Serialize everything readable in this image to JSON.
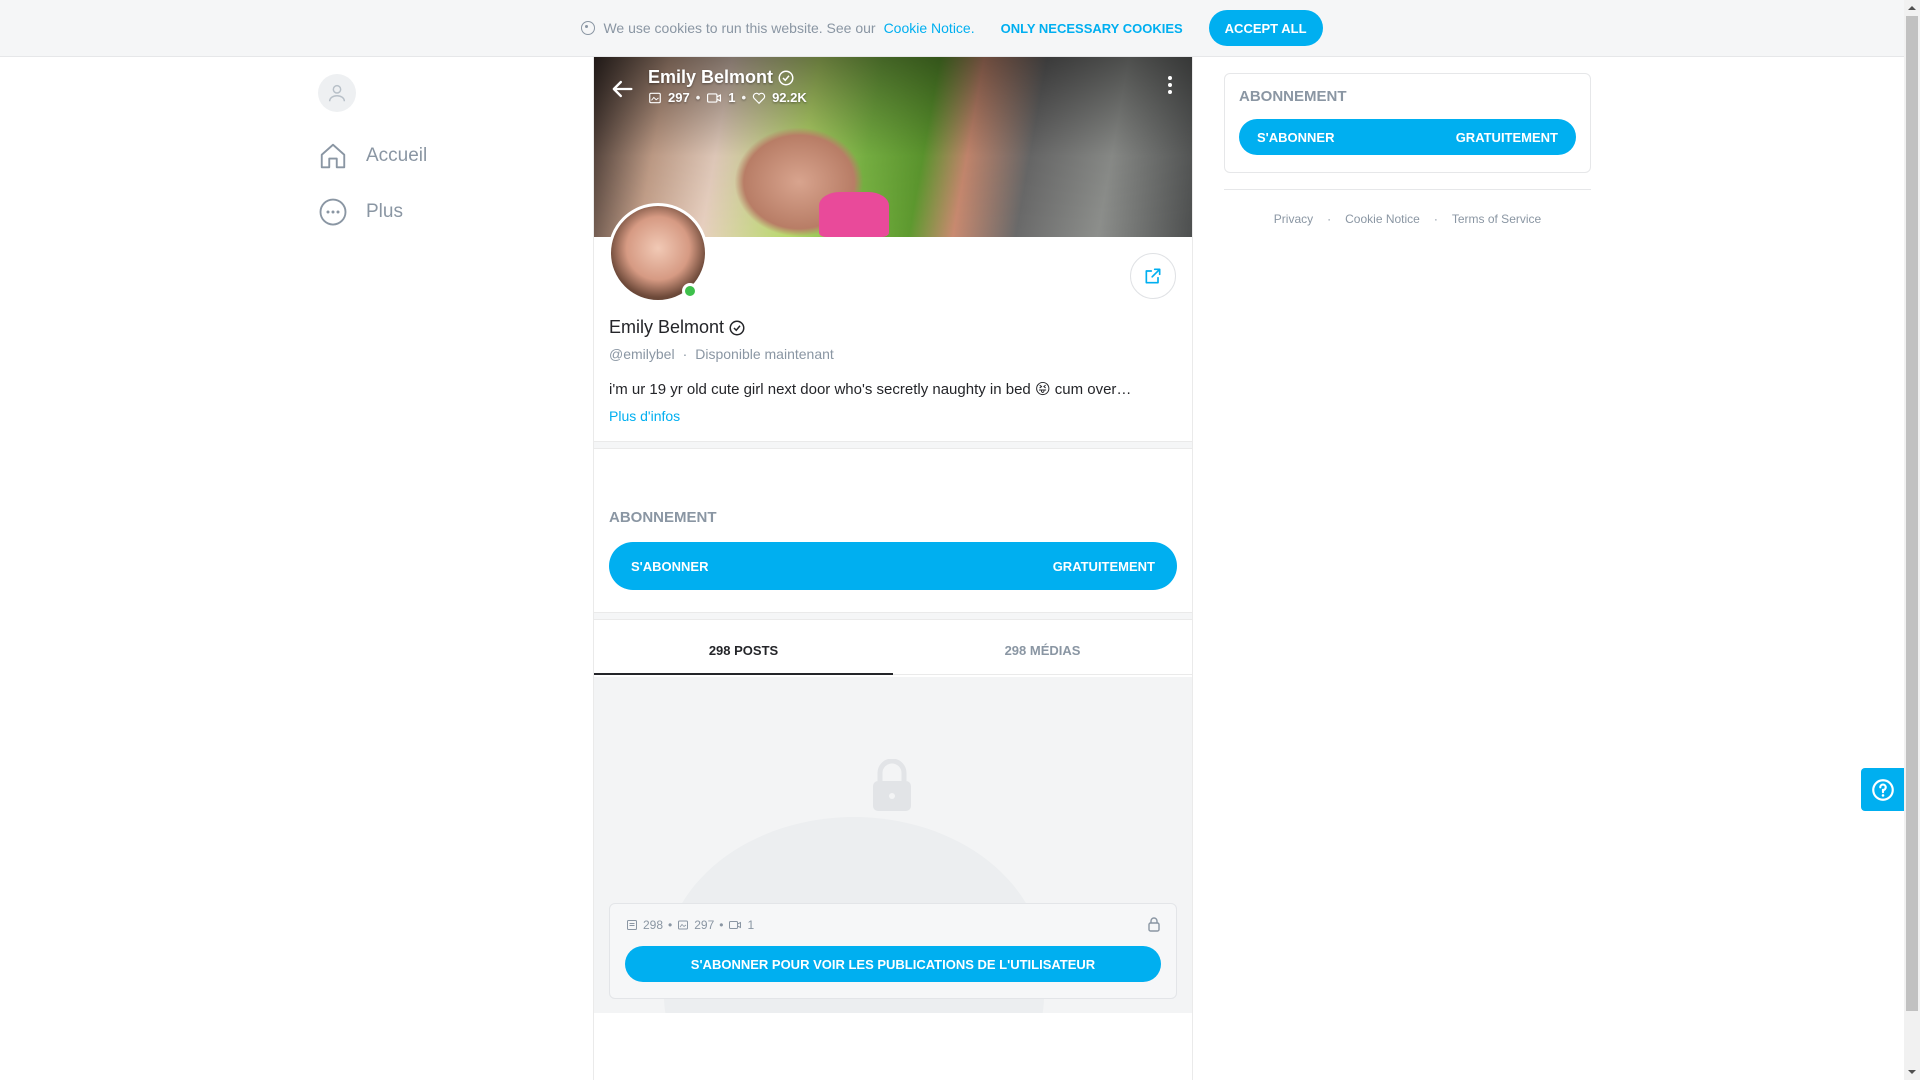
{
  "cookie_bar": {
    "message": "We use cookies to run this website. See our",
    "link_text": "Cookie Notice.",
    "only_necessary": "ONLY NECESSARY COOKIES",
    "accept_all": "ACCEPT ALL"
  },
  "sidebar": {
    "items": [
      {
        "label": "Accueil",
        "icon": "home-icon"
      },
      {
        "label": "Plus",
        "icon": "more-icon"
      }
    ]
  },
  "profile": {
    "name": "Emily Belmont",
    "stats": {
      "photos": "297",
      "videos": "1",
      "likes": "92.2K"
    },
    "handle": "@emilybel",
    "status": "Disponible maintenant",
    "bio": "i'm ur 19 yr old cute girl next door who's secretly naughty in bed 😝 cum over…",
    "more_info": "Plus d'infos"
  },
  "subscription": {
    "title": "ABONNEMENT",
    "button_left": "S'ABONNER",
    "button_right": "GRATUITEMENT"
  },
  "tabs": [
    {
      "label": "298 POSTS",
      "active": true
    },
    {
      "label": "298 MÉDIAS",
      "active": false
    }
  ],
  "locked": {
    "posts": "298",
    "photos": "297",
    "videos": "1",
    "button": "S'ABONNER POUR VOIR LES PUBLICATIONS DE L'UTILISATEUR"
  },
  "right_panel": {
    "title": "ABONNEMENT",
    "button_left": "S'ABONNER",
    "button_right": "GRATUITEMENT"
  },
  "footer": {
    "links": [
      "Privacy",
      "Cookie Notice",
      "Terms of Service"
    ]
  },
  "colors": {
    "accent": "#00aff0",
    "online": "#3ec04b",
    "muted": "#8a96a3"
  }
}
